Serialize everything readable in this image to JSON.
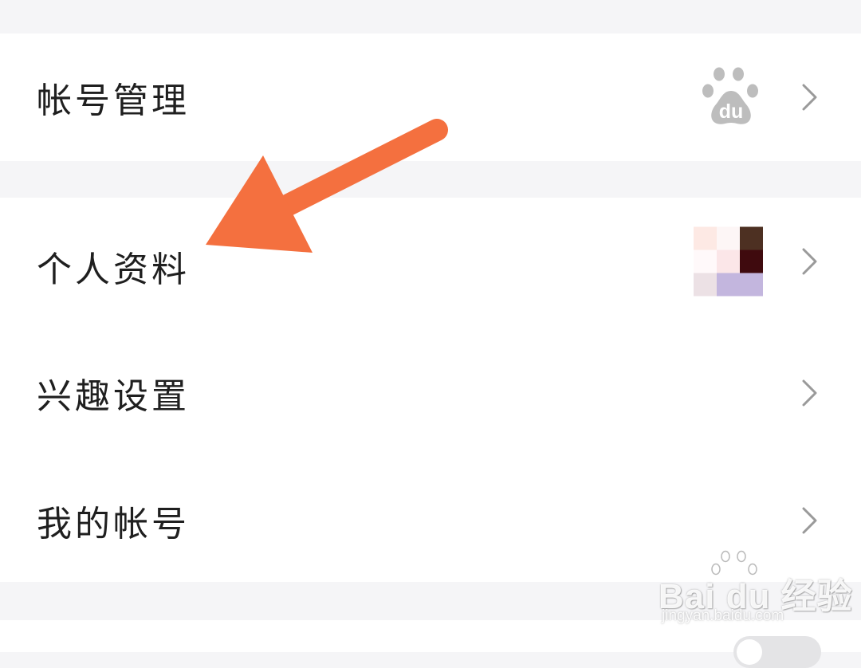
{
  "settings": {
    "account_section": {
      "rows": [
        {
          "label": "帐号管理",
          "icon": "baidu-paw-logo",
          "chevron": "chevron-right-icon"
        }
      ]
    },
    "profile_section": {
      "rows": [
        {
          "label": "个人资料",
          "icon": "avatar-thumbnail",
          "chevron": "chevron-right-icon"
        },
        {
          "label": "兴趣设置",
          "chevron": "chevron-right-icon"
        },
        {
          "label": "我的帐号",
          "chevron": "chevron-right-icon"
        }
      ]
    }
  },
  "annotation": {
    "type": "arrow",
    "color": "#f4703f",
    "points_to": "个人资料"
  },
  "watermark": {
    "brand": "Bai du 经验",
    "url": "jingyan.baidu.com"
  },
  "colors": {
    "background": "#f5f5f7",
    "row_background": "#ffffff",
    "label_text": "#1f1f1f",
    "chevron": "#9a9a9a",
    "arrow": "#f4703f",
    "avatar_pixels": [
      "#fde9e4",
      "#fdf6f6",
      "#4d3022",
      "#fff9fa",
      "#fbe6e8",
      "#3f0a0e",
      "#ece1e5",
      "#c3b6de",
      "#c3b6de"
    ]
  }
}
